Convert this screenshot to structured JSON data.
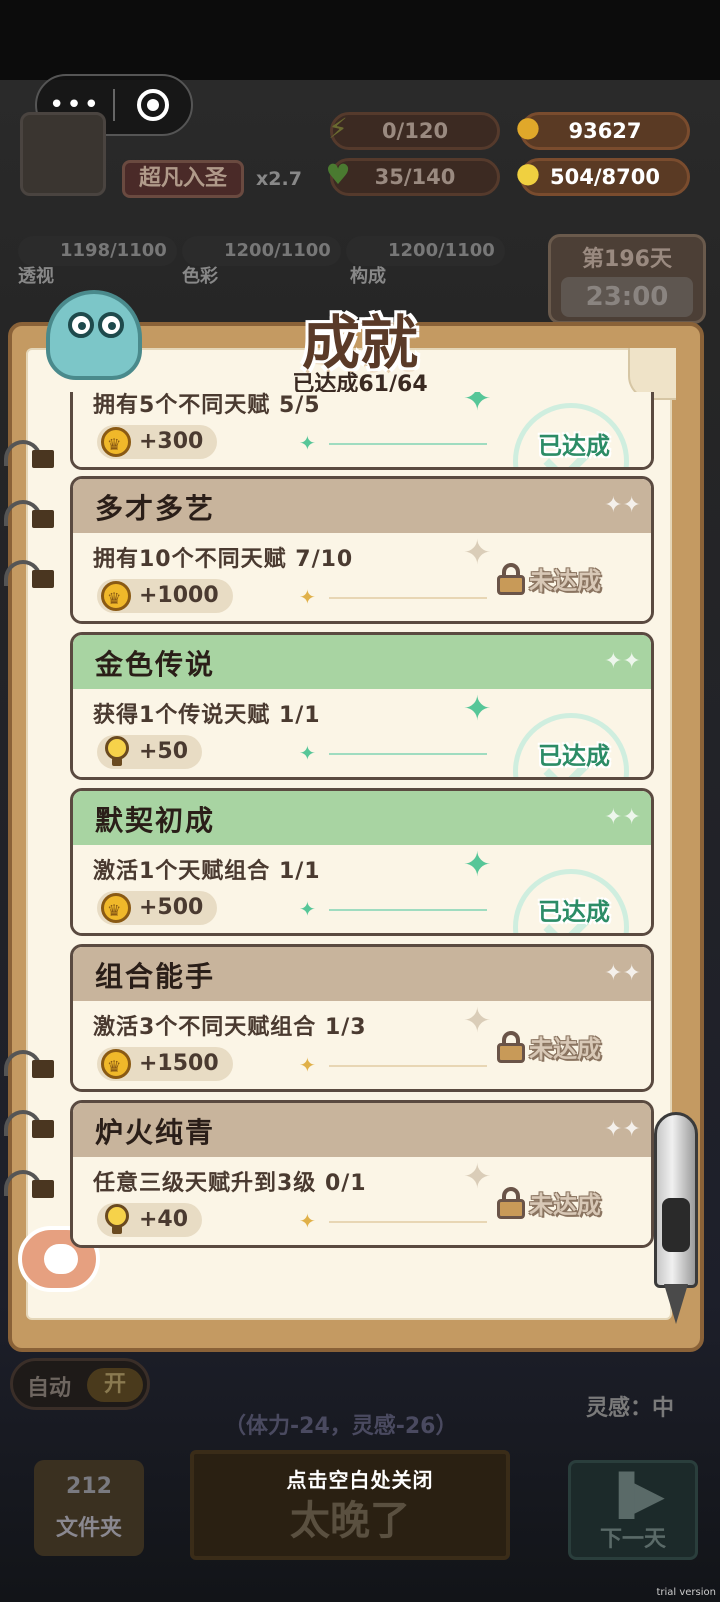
{
  "capsule": {
    "more": "•••"
  },
  "hud": {
    "title_badge": "超凡入圣",
    "multiplier": "x2.7",
    "energy": "0/120",
    "health": "35/140",
    "gold": "93627",
    "ideas": "504/8700"
  },
  "skills": [
    {
      "value": "1198/1100",
      "label": "透视"
    },
    {
      "value": "1200/1100",
      "label": "色彩"
    },
    {
      "value": "1200/1100",
      "label": "构成"
    }
  ],
  "day": {
    "label": "第196天",
    "time": "23:00"
  },
  "modal": {
    "title": "成就",
    "count": "已达成61/64",
    "achievements": [
      {
        "name": "",
        "desc": "拥有5个不同天赋 5/5",
        "reward": "+300",
        "reward_icon": "coin-icon",
        "status": "已达成",
        "done": true
      },
      {
        "name": "多才多艺",
        "desc": "拥有10个不同天赋 7/10",
        "reward": "+1000",
        "reward_icon": "coin-icon",
        "status": "未达成",
        "done": false
      },
      {
        "name": "金色传说",
        "desc": "获得1个传说天赋 1/1",
        "reward": "+50",
        "reward_icon": "lightbulb-icon",
        "status": "已达成",
        "done": true
      },
      {
        "name": "默契初成",
        "desc": "激活1个天赋组合 1/1",
        "reward": "+500",
        "reward_icon": "coin-icon",
        "status": "已达成",
        "done": true
      },
      {
        "name": "组合能手",
        "desc": "激活3个不同天赋组合 1/3",
        "reward": "+1500",
        "reward_icon": "coin-icon",
        "status": "未达成",
        "done": false
      },
      {
        "name": "炉火纯青",
        "desc": "任意三级天赋升到3级 0/1",
        "reward": "+40",
        "reward_icon": "lightbulb-icon",
        "status": "未达成",
        "done": false
      }
    ],
    "close_hint": "点击空白处关闭"
  },
  "bottom": {
    "auto_label": "自动",
    "auto_value": "开",
    "inspiration": "灵感：中",
    "cost": "（体力-24，灵感-26）",
    "folder_count": "212",
    "folder_label": "文件夹",
    "main_button": "太晚了",
    "next_label": "下一天"
  },
  "watermark": "trial version",
  "colors": {
    "panel_wood": "#c49a62",
    "paper": "#fbf5e6",
    "card_header_pending": "#c8b49c",
    "card_header_done": "#a8d4a2",
    "done_text": "#2c8c66"
  }
}
